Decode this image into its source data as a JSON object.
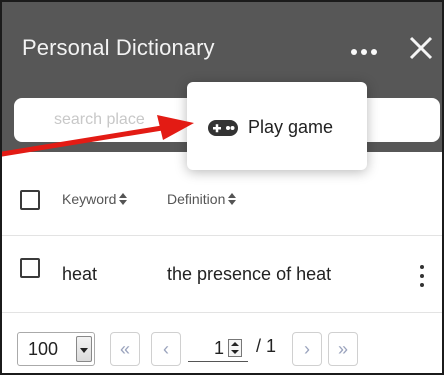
{
  "header": {
    "title": "Personal Dictionary"
  },
  "search": {
    "placeholder": "search place"
  },
  "table": {
    "columns": [
      "Keyword",
      "Definition"
    ],
    "rows": [
      {
        "keyword": "heat",
        "definition": "the presence of heat"
      }
    ]
  },
  "pagination": {
    "page_size": "100",
    "current_page": "1",
    "total_label": "/ 1",
    "first_icon": "«",
    "prev_icon": "‹",
    "next_icon": "›",
    "last_icon": "»"
  },
  "menu": {
    "play_game_label": "Play game",
    "icon": "gamepad-icon"
  },
  "colors": {
    "header_bg": "#575757",
    "annotation_arrow": "#e31b14",
    "pager_icon": "#9aa3bd"
  }
}
